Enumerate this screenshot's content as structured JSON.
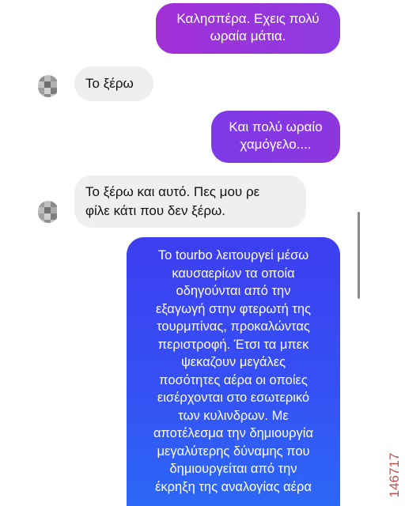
{
  "chat": {
    "messages": [
      {
        "role": "sent",
        "text": "Καλησπέρα. Εχεις πολύ\nωραία μάτια."
      },
      {
        "role": "received",
        "text": "Το ξέρω"
      },
      {
        "role": "sent",
        "text": "Και πολύ ωραίο\nχαμόγελο...."
      },
      {
        "role": "received",
        "text": "Το ξέρω και αυτό. Πες μου ρε\nφίλε κάτι που δεν ξέρω."
      },
      {
        "role": "sent",
        "text": "Το tourbo λειτουργεί μέσω\nκαυσαερίων τα οποία\nοδηγούνται από την\nεξαγωγή στην φτερωτή της\nτουρμπίνας, προκαλώντας\nπεριστροφή. Έτσι τα μπεκ\nψεκαζουν μεγάλες\nποσότητες αέρα οι οποίες\nεισέρχονται στο εσωτερικό\nτων κυλινδρων. Με\nαποτέλεσμα την δημιουργία\nμεγαλύτερης δύναμης που\nδημιουργείται από την\nέκρηξη της αναλογίας αέρα"
      }
    ]
  },
  "watermark": "146717",
  "colors": {
    "sent_gradient": [
      "#9b2fd9",
      "#3f3ff0",
      "#2d62f5"
    ],
    "received_bubble": "#efefef"
  }
}
